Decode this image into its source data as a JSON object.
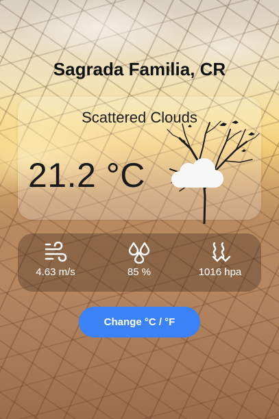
{
  "location": {
    "title": "Sagrada Familia, CR"
  },
  "weather": {
    "description": "Scattered Clouds",
    "temperature": "21.2 °C",
    "condition_icon": "cloud-icon"
  },
  "stats": {
    "wind": {
      "icon": "wind-icon",
      "value": "4.63 m/s"
    },
    "humidity": {
      "icon": "droplets-icon",
      "value": "85 %"
    },
    "pressure": {
      "icon": "pressure-waves-icon",
      "value": "1016 hpa"
    }
  },
  "controls": {
    "unit_toggle_label": "Change °C / °F"
  }
}
